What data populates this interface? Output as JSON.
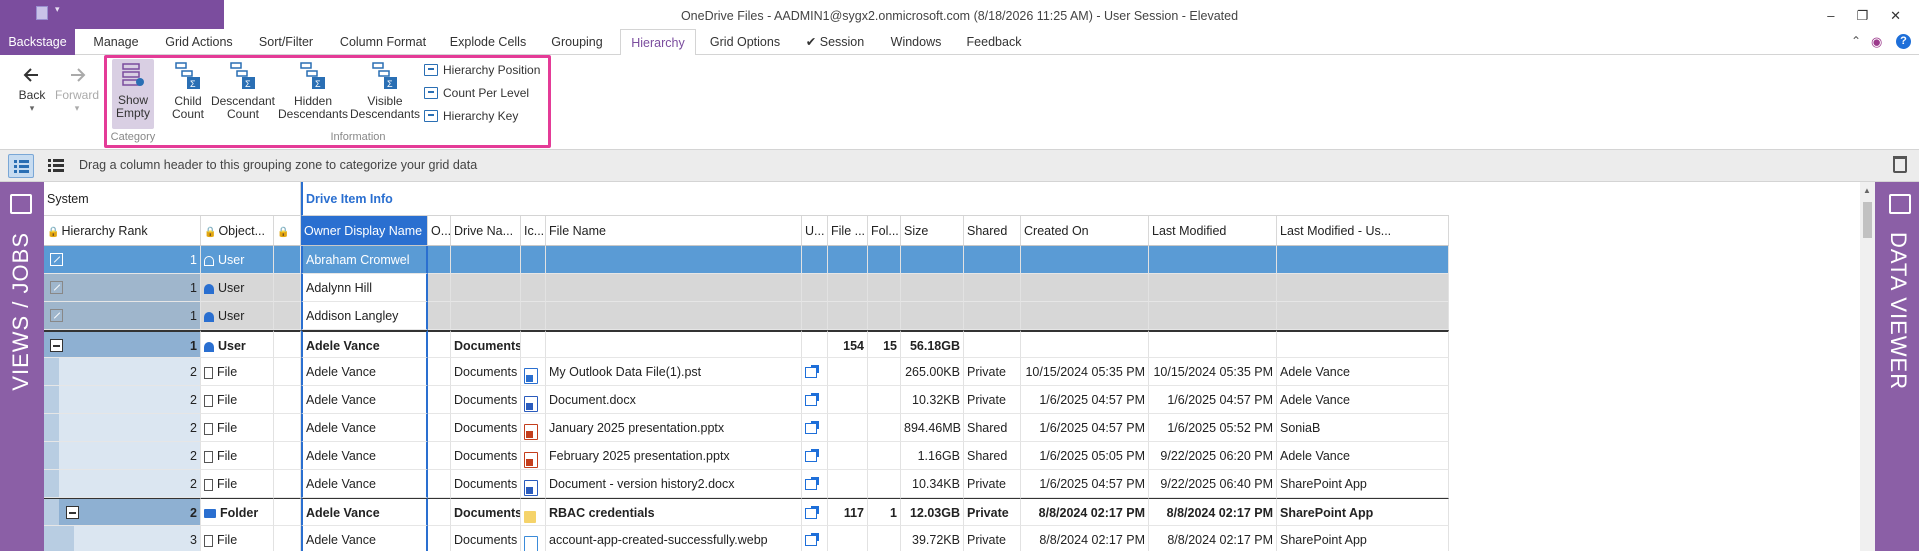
{
  "window": {
    "title": "OneDrive Files - AADMIN1@sygx2.onmicrosoft.com (8/18/2026 11:25 AM) - User Session - Elevated",
    "controls": {
      "minimize": "–",
      "restore": "❐",
      "close": "✕"
    }
  },
  "ribbon_tabs": {
    "backstage": "Backstage",
    "items": [
      {
        "label": "Manage"
      },
      {
        "label": "Grid Actions"
      },
      {
        "label": "Sort/Filter"
      },
      {
        "label": "Column Format"
      },
      {
        "label": "Explode Cells"
      },
      {
        "label": "Grouping"
      },
      {
        "label": "Hierarchy",
        "active": true
      },
      {
        "label": "Grid Options"
      },
      {
        "label": "✔ Session"
      },
      {
        "label": "Windows"
      },
      {
        "label": "Feedback"
      }
    ],
    "collapse_caret": "⌃",
    "help": "?"
  },
  "ribbon": {
    "back": "Back",
    "forward": "Forward",
    "show_empty": {
      "line1": "Show",
      "line2": "Empty"
    },
    "category_label": "Category",
    "child_count": {
      "line1": "Child",
      "line2": "Count"
    },
    "descendant_count": {
      "line1": "Descendant",
      "line2": "Count"
    },
    "hidden_descendants": {
      "line1": "Hidden",
      "line2": "Descendants"
    },
    "visible_descendants": {
      "line1": "Visible",
      "line2": "Descendants"
    },
    "hierarchy_position": "Hierarchy Position",
    "count_per_level": "Count Per Level",
    "hierarchy_key": "Hierarchy Key",
    "information_label": "Information",
    "highlight_color": "#e43b97"
  },
  "groupbar": {
    "text": "Drag a column header to this grouping zone to categorize your grid data"
  },
  "side_panels": {
    "left": "VIEWS / JOBS",
    "right": "DATA VIEWER",
    "color": "#8b5fa6"
  },
  "grid": {
    "bands": {
      "system": "System",
      "drive": "Drive Item Info"
    },
    "headers": {
      "rank": "Hierarchy Rank",
      "object": "Object...",
      "owner": "Owner Display Name",
      "o": "O...",
      "drive": "Drive Na...",
      "ic": "Ic...",
      "filename": "File Name",
      "u": "U...",
      "filecount": "File ...",
      "folcount": "Fol...",
      "size": "Size",
      "shared": "Shared",
      "created": "Created On",
      "modified": "Last Modified",
      "modifiedby": "Last Modified - Us..."
    },
    "rows": [
      {
        "rank": "1",
        "object": "User",
        "owner": "Abraham Cromwel",
        "drive": "",
        "filename": "",
        "filecount": "",
        "folcount": "",
        "size": "",
        "shared": "",
        "created": "",
        "modified": "",
        "modifiedby": ""
      },
      {
        "rank": "1",
        "object": "User",
        "owner": "Adalynn Hill",
        "drive": "",
        "filename": "",
        "filecount": "",
        "folcount": "",
        "size": "",
        "shared": "",
        "created": "",
        "modified": "",
        "modifiedby": ""
      },
      {
        "rank": "1",
        "object": "User",
        "owner": "Addison Langley",
        "drive": "",
        "filename": "",
        "filecount": "",
        "folcount": "",
        "size": "",
        "shared": "",
        "created": "",
        "modified": "",
        "modifiedby": ""
      },
      {
        "rank": "1",
        "object": "User",
        "owner": "Adele Vance",
        "drive": "Documents",
        "filename": "",
        "filecount": "154",
        "folcount": "15",
        "size": "56.18GB",
        "shared": "",
        "created": "",
        "modified": "",
        "modifiedby": ""
      },
      {
        "rank": "2",
        "object": "File",
        "owner": "Adele Vance",
        "drive": "Documents",
        "filename": "My Outlook Data File(1).pst",
        "filecount": "",
        "folcount": "",
        "size": "265.00KB",
        "shared": "Private",
        "created": "10/15/2024 05:35 PM",
        "modified": "10/15/2024 05:35 PM",
        "modifiedby": "Adele Vance"
      },
      {
        "rank": "2",
        "object": "File",
        "owner": "Adele Vance",
        "drive": "Documents",
        "filename": "Document.docx",
        "filecount": "",
        "folcount": "",
        "size": "10.32KB",
        "shared": "Private",
        "created": "1/6/2025 04:57 PM",
        "modified": "1/6/2025 04:57 PM",
        "modifiedby": "Adele Vance"
      },
      {
        "rank": "2",
        "object": "File",
        "owner": "Adele Vance",
        "drive": "Documents",
        "filename": "January 2025 presentation.pptx",
        "filecount": "",
        "folcount": "",
        "size": "894.46MB",
        "shared": "Shared",
        "created": "1/6/2025 04:57 PM",
        "modified": "1/6/2025 05:52 PM",
        "modifiedby": "SoniaB"
      },
      {
        "rank": "2",
        "object": "File",
        "owner": "Adele Vance",
        "drive": "Documents",
        "filename": "February 2025 presentation.pptx",
        "filecount": "",
        "folcount": "",
        "size": "1.16GB",
        "shared": "Shared",
        "created": "1/6/2025 05:05 PM",
        "modified": "9/22/2025 06:20 PM",
        "modifiedby": "Adele Vance"
      },
      {
        "rank": "2",
        "object": "File",
        "owner": "Adele Vance",
        "drive": "Documents",
        "filename": "Document - version history2.docx",
        "filecount": "",
        "folcount": "",
        "size": "10.34KB",
        "shared": "Private",
        "created": "1/6/2025 04:57 PM",
        "modified": "9/22/2025 06:40 PM",
        "modifiedby": "SharePoint App"
      },
      {
        "rank": "2",
        "object": "Folder",
        "owner": "Adele Vance",
        "drive": "Documents",
        "filename": "RBAC credentials",
        "filecount": "117",
        "folcount": "1",
        "size": "12.03GB",
        "shared": "Private",
        "created": "8/8/2024 02:17 PM",
        "modified": "8/8/2024 02:17 PM",
        "modifiedby": "SharePoint App"
      },
      {
        "rank": "3",
        "object": "File",
        "owner": "Adele Vance",
        "drive": "Documents",
        "filename": "account-app-created-successfully.webp",
        "filecount": "",
        "folcount": "",
        "size": "39.72KB",
        "shared": "Private",
        "created": "8/8/2024 02:17 PM",
        "modified": "8/8/2024 02:17 PM",
        "modifiedby": "SharePoint App"
      }
    ]
  }
}
